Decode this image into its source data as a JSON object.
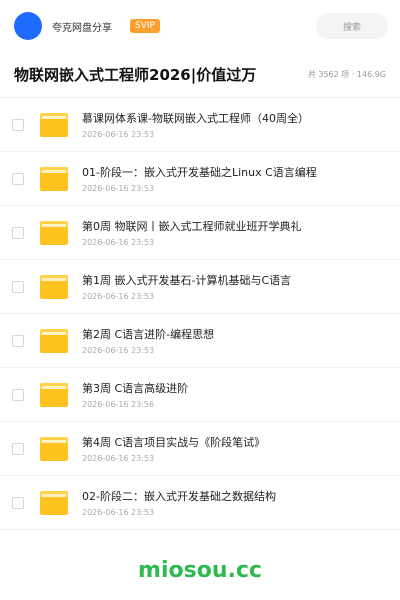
{
  "header": {
    "brand": "夸克网盘分享",
    "badge": "SVIP",
    "search_placeholder": "搜索",
    "colors": {
      "avatar": "#1f6bff",
      "badge": "#ff9f2e"
    }
  },
  "share": {
    "title": "物联网嵌入式工程师2026|价值过万",
    "stats": "共 3562 项 · 146.9G"
  },
  "files": [
    {
      "name": "慕课网体系课-物联网嵌入式工程师（40周全）",
      "date": "2026-06-16 23:53",
      "icon": "folder-icon"
    },
    {
      "name": "01-阶段一：嵌入式开发基础之Linux C语言编程",
      "date": "2026-06-16 23:53",
      "icon": "folder-icon"
    },
    {
      "name": "第0周 物联网丨嵌入式工程师就业班开学典礼",
      "date": "2026-06-16 23:53",
      "icon": "folder-icon"
    },
    {
      "name": "第1周 嵌入式开发基石-计算机基础与C语言",
      "date": "2026-06-16 23:53",
      "icon": "folder-icon"
    },
    {
      "name": "第2周 C语言进阶-编程思想",
      "date": "2026-06-16 23:53",
      "icon": "folder-icon"
    },
    {
      "name": "第3周 C语言高级进阶",
      "date": "2026-06-16 23:56",
      "icon": "folder-icon"
    },
    {
      "name": "第4周 C语言项目实战与《阶段笔试》",
      "date": "2026-06-16 23:53",
      "icon": "folder-icon"
    },
    {
      "name": "02-阶段二：嵌入式开发基础之数据结构",
      "date": "2026-06-16 23:53",
      "icon": "folder-icon"
    }
  ],
  "watermark": "miosou.cc"
}
